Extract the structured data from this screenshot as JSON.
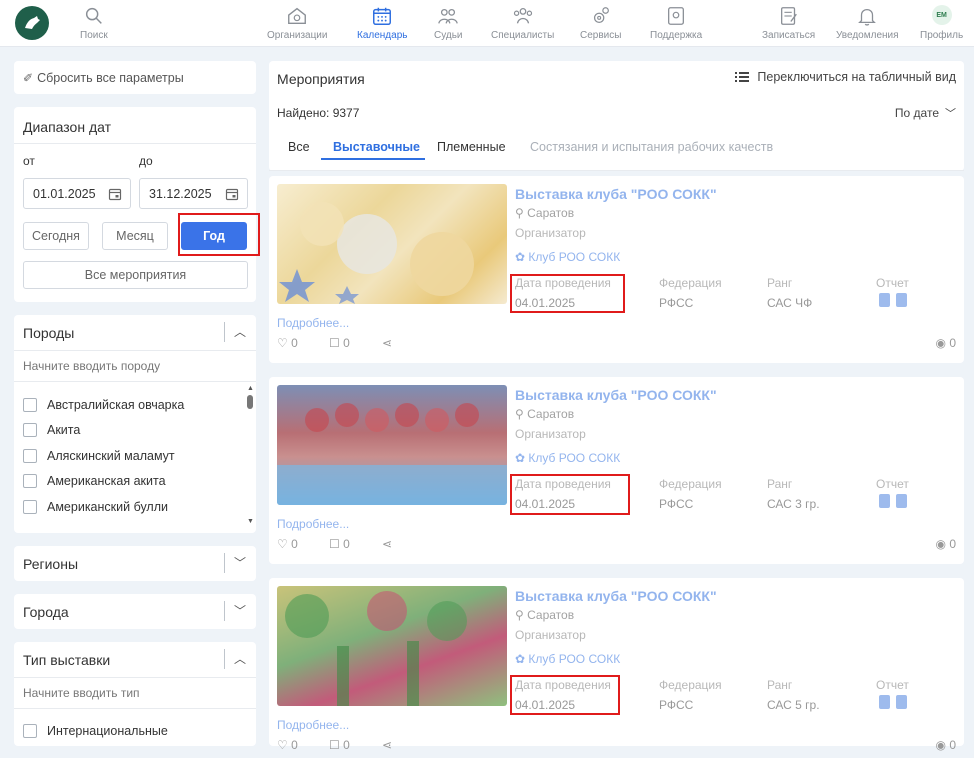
{
  "nav": {
    "items": [
      {
        "label": "Поиск"
      },
      {
        "label": "Организации"
      },
      {
        "label": "Календарь"
      },
      {
        "label": "Судьи"
      },
      {
        "label": "Специалисты"
      },
      {
        "label": "Сервисы"
      },
      {
        "label": "Поддержка"
      },
      {
        "label": "Записаться"
      },
      {
        "label": "Уведомления"
      },
      {
        "label": "Профиль"
      }
    ],
    "avatar_initials": "ЕМ",
    "active": "Календарь",
    "accent": "#2f6fe0"
  },
  "sidebar": {
    "reset_label": "Сбросить все параметры",
    "date_range": {
      "title": "Диапазон дат",
      "from_label": "от",
      "to_label": "до",
      "from_value": "01.01.2025",
      "to_value": "31.12.2025",
      "today": "Сегодня",
      "month": "Месяц",
      "year": "Год",
      "all_events": "Все мероприятия"
    },
    "breeds": {
      "title": "Породы",
      "placeholder": "Начните вводить породу",
      "items": [
        "Австралийская овчарка",
        "Акита",
        "Аляскинский маламут",
        "Американская акита",
        "Американский булли"
      ]
    },
    "regions": {
      "title": "Регионы"
    },
    "cities": {
      "title": "Города"
    },
    "show_type": {
      "title": "Тип выставки",
      "placeholder": "Начните вводить тип",
      "items": [
        "Интернациональные"
      ]
    }
  },
  "main": {
    "title": "Мероприятия",
    "switch_view": "Переключиться на табличный вид",
    "found": "Найдено: 9377",
    "sort": "По дате",
    "tabs": [
      "Все",
      "Выставочные",
      "Племенные",
      "Состязания и испытания рабочих качеств"
    ],
    "active_tab": "Выставочные",
    "labels": {
      "organizer": "Организатор",
      "date": "Дата проведения",
      "federation": "Федерация",
      "rank": "Ранг",
      "report": "Отчет",
      "more": "Подробнее..."
    },
    "events": [
      {
        "title": "Выставка клуба \"РОО СОКК\"",
        "city": "Саратов",
        "club": "Клуб РОО СОКК",
        "date": "04.01.2025",
        "federation": "РФСС",
        "rank": "САС ЧФ",
        "likes": "0",
        "comments": "0",
        "views": "0"
      },
      {
        "title": "Выставка клуба \"РОО СОКК\"",
        "city": "Саратов",
        "club": "Клуб РОО СОКК",
        "date": "04.01.2025",
        "federation": "РФСС",
        "rank": "САС 3 гр.",
        "likes": "0",
        "comments": "0",
        "views": "0"
      },
      {
        "title": "Выставка клуба \"РОО СОКК\"",
        "city": "Саратов",
        "club": "Клуб РОО СОКК",
        "date": "04.01.2025",
        "federation": "РФСС",
        "rank": "САС 5 гр.",
        "likes": "0",
        "comments": "0",
        "views": "0"
      }
    ]
  }
}
